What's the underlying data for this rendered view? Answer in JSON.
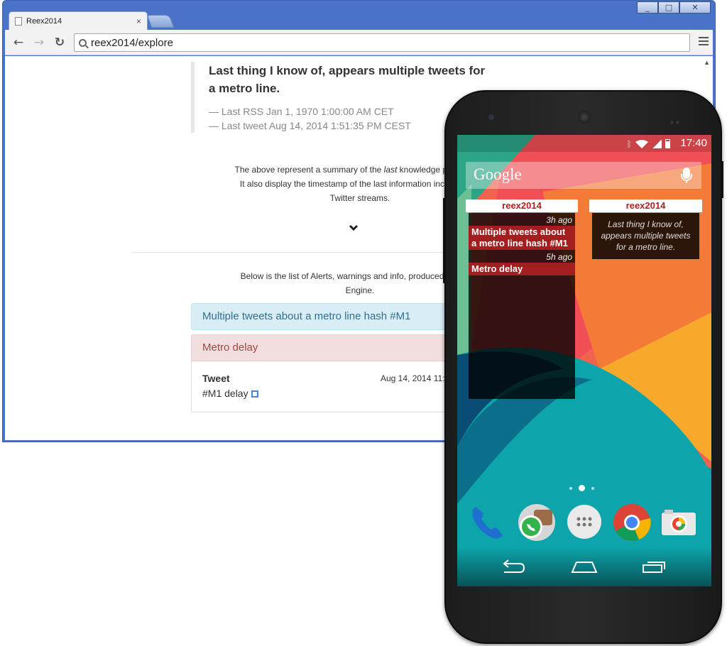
{
  "window": {
    "controls": [
      "_",
      "□",
      "✕"
    ]
  },
  "tab": {
    "title": "Reex2014",
    "close": "×"
  },
  "toolbar": {
    "back": "←",
    "forward": "→",
    "reload": "↻",
    "url": "reex2014/explore"
  },
  "page": {
    "quote_text": "Last thing I know of, appears multiple tweets for a metro line.",
    "last_rss": "— Last RSS Jan 1, 1970 1:00:00 AM CET",
    "last_tweet": "— Last tweet Aug 14, 2014 1:51:35 PM CEST",
    "summary_pre": "The above represent a summary of the ",
    "summary_em": "last",
    "summary_post": " knowledge produced b",
    "summary_line2": "It also display the timestamp of the last information incoming fro",
    "summary_line3": "Twitter streams.",
    "chevron": "⌄",
    "below_line1": "Below is the list of Alerts, warnings and info, produced as knowl",
    "below_line2": "Engine.",
    "alert_info": "Multiple tweets about a metro line hash #M1",
    "alert_danger": "Metro delay",
    "tweet_label": "Tweet",
    "tweet_date": "Aug 14, 2014 11:",
    "tweet_body": "#M1 delay"
  },
  "phone": {
    "time": "17:40",
    "search_logo": "Google",
    "widget_left": {
      "header": "reex2014",
      "items": [
        {
          "ago": "3h ago",
          "text": "Multiple tweets about a metro line hash #M1"
        },
        {
          "ago": "5h ago",
          "text": "Metro delay"
        }
      ]
    },
    "widget_right": {
      "header": "reex2014",
      "text": "Last thing I know of, appears multiple tweets for a metro line."
    },
    "dock_apps": [
      "phone",
      "whatsapp",
      "app-drawer",
      "chrome",
      "camera"
    ]
  },
  "colors": {
    "accent_red": "#a31e1e",
    "info_bg": "#d9edf7",
    "danger_bg": "#f2dede",
    "window_frame": "#4a72c8"
  }
}
